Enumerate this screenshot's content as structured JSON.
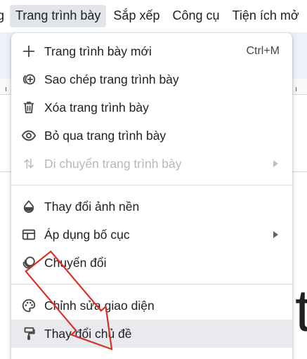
{
  "menubar": {
    "items": [
      {
        "label": "g"
      },
      {
        "label": "Trang trình bày"
      },
      {
        "label": "Sắp xếp"
      },
      {
        "label": "Công cụ"
      },
      {
        "label": "Tiện ích mở"
      }
    ],
    "active_index": 1
  },
  "slide": {
    "partial_text": "t"
  },
  "menu": {
    "items": [
      {
        "label": "Trang trình bày mới",
        "icon": "plus-icon",
        "shortcut": "Ctrl+M"
      },
      {
        "label": "Sao chép trang trình bày",
        "icon": "duplicate-icon"
      },
      {
        "label": "Xóa trang trình bày",
        "icon": "trash-icon"
      },
      {
        "label": "Bỏ qua trang trình bày",
        "icon": "eye-icon"
      },
      {
        "label": "Di chuyển trang trình bày",
        "icon": "move-arrows-icon",
        "disabled": true,
        "submenu": true
      },
      {
        "label": "Thay đổi ảnh nền",
        "icon": "color-drop-icon"
      },
      {
        "label": "Áp dụng bố cục",
        "icon": "layout-icon",
        "submenu": true
      },
      {
        "label": "Chuyển đổi",
        "icon": "transition-icon"
      },
      {
        "label": "Chỉnh sửa giao diện",
        "icon": "palette-icon"
      },
      {
        "label": "Thay đổi chủ đề",
        "icon": "paint-roller-icon",
        "highlighted": true
      }
    ]
  },
  "colors": {
    "annotation_arrow": "#d93025",
    "highlight": "#e8eaed",
    "active_menubar": "#e1e5ea"
  }
}
